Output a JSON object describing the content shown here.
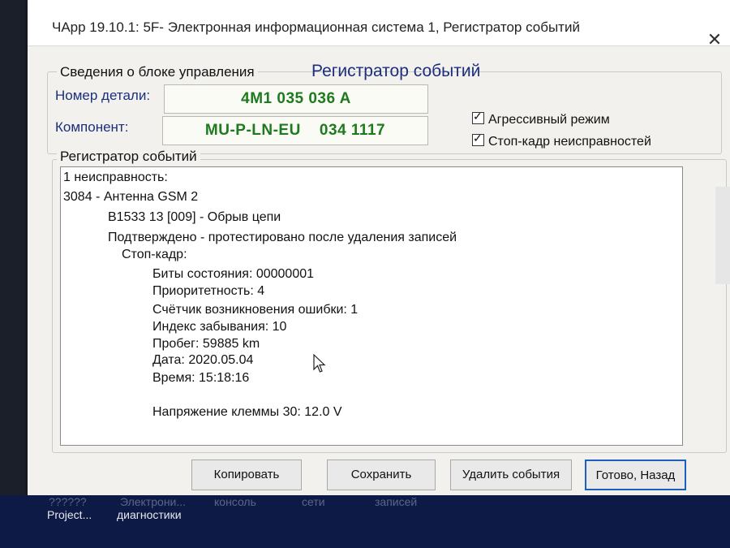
{
  "window": {
    "title": "ЧАрр 19.10.1: 5F- Электронная информационная система 1,  Регистратор событий",
    "close_label": "✕"
  },
  "ecu_group": {
    "label": "Сведения о блоке управления",
    "main_title": "Регистратор событий",
    "part_number_label": "Номер детали:",
    "part_number_value": "4M1 035 036 A",
    "component_label": "Компонент:",
    "component_value": "MU-P-LN-EU    034 1117"
  },
  "options": {
    "aggressive_mode": {
      "label": "Агрессивный режим",
      "checked": true
    },
    "freeze_frame": {
      "label": "Стоп-кадр неисправностей",
      "checked": true
    }
  },
  "event_log": {
    "label": "Регистратор событий",
    "lines": [
      "1 неисправность:",
      "3084 - Антенна GSM 2",
      "B1533 13 [009] - Обрыв цепи",
      "Подтверждено - протестировано после удаления записей",
      "Стоп-кадр:",
      "Биты состояния: 00000001",
      "Приоритетность: 4",
      "Счётчик возникновения ошибки: 1",
      "Индекс забывания: 10",
      "Пробег: 59885 km",
      "Дата: 2020.05.04",
      "Время: 15:18:16",
      "Напряжение клеммы 30: 12.0 V"
    ]
  },
  "buttons": {
    "copy": "Копировать",
    "save": "Сохранить",
    "delete_events": "Удалить события",
    "done_back": "Готово, Назад"
  },
  "desktop": {
    "item1_top": "??????",
    "item2_top": "Электрони...",
    "item3_top": "консоль",
    "item4_top": "сети",
    "item5_top": "записей",
    "item1": "Project...",
    "item2": "диагностики"
  }
}
